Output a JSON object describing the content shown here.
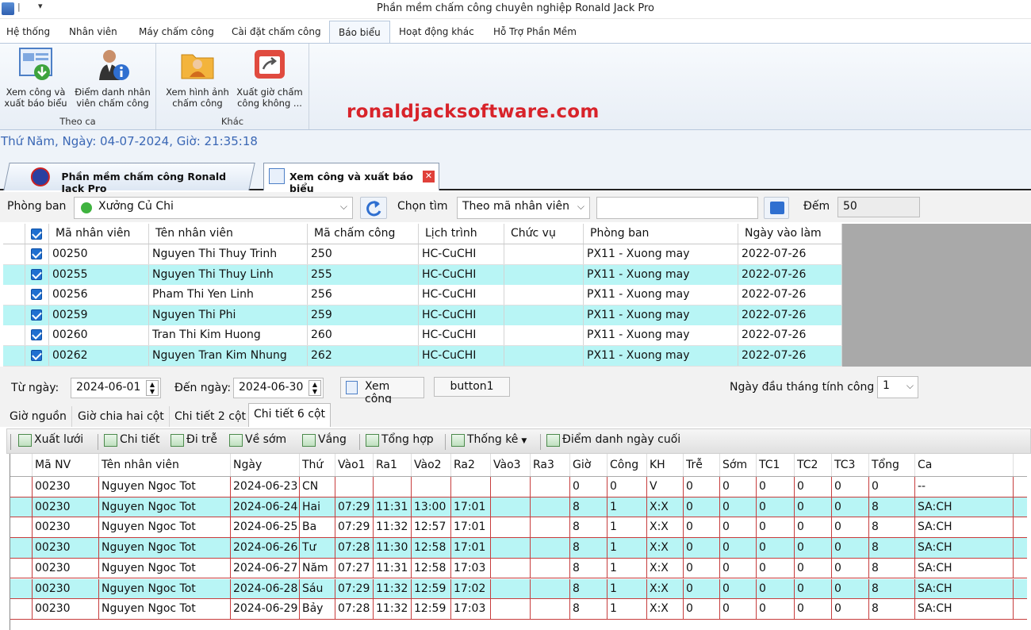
{
  "window": {
    "title": "Phần mềm chấm công chuyên nghiệp Ronald Jack Pro"
  },
  "menu": [
    "Hệ thống",
    "Nhân viên",
    "Máy chấm công",
    "Cài đặt chấm công",
    "Báo biểu",
    "Hoạt động khác",
    "Hỗ Trợ Phần Mềm"
  ],
  "ribbon": {
    "groups": [
      {
        "label": "Theo ca",
        "buttons": [
          "Xem công và xuất báo biểu",
          "Điểm danh nhân viên chấm công"
        ]
      },
      {
        "label": "Khác",
        "buttons": [
          "Xem hình ảnh chấm công",
          "Xuất giờ chấm công không ..."
        ]
      }
    ]
  },
  "watermark": "ronaldjacksoftware.com",
  "datetime": "Thứ Năm, Ngày: 04-07-2024, Giờ: 21:35:18",
  "doc_tabs": [
    "Phần mềm chấm công Ronald Jack Pro",
    "Xem công và xuất báo biểu"
  ],
  "filter": {
    "dept_label": "Phòng ban",
    "dept_value": "Xưởng Củ Chi",
    "search_label": "Chọn tìm",
    "search_mode": "Theo mã nhân viên",
    "search_text": "",
    "count_label": "Đếm",
    "count_value": "50"
  },
  "employees": {
    "columns": [
      "Mã nhân viên",
      "Tên nhân viên",
      "Mã chấm công",
      "Lịch trình",
      "Chức vụ",
      "Phòng ban",
      "Ngày vào làm"
    ],
    "rows": [
      [
        "00250",
        "Nguyen Thi Thuy Trinh",
        "250",
        "HC-CuCHI",
        "",
        "PX11 - Xuong may",
        "2022-07-26"
      ],
      [
        "00255",
        "Nguyen Thi Thuy Linh",
        "255",
        "HC-CuCHI",
        "",
        "PX11 - Xuong may",
        "2022-07-26"
      ],
      [
        "00256",
        "Pham Thi Yen Linh",
        "256",
        "HC-CuCHI",
        "",
        "PX11 - Xuong may",
        "2022-07-26"
      ],
      [
        "00259",
        "Nguyen Thi Phi",
        "259",
        "HC-CuCHI",
        "",
        "PX11 - Xuong may",
        "2022-07-26"
      ],
      [
        "00260",
        "Tran Thi Kim Huong",
        "260",
        "HC-CuCHI",
        "",
        "PX11 - Xuong may",
        "2022-07-26"
      ],
      [
        "00262",
        "Nguyen Tran Kim Nhung",
        "262",
        "HC-CuCHI",
        "",
        "PX11 - Xuong may",
        "2022-07-26"
      ]
    ]
  },
  "date_range": {
    "from_label": "Từ ngày:",
    "from_value": "2024-06-01",
    "to_label": "Đến ngày:",
    "to_value": "2024-06-30",
    "view_button": "Xem công",
    "button1": "button1",
    "first_day_label": "Ngày đầu tháng tính công",
    "first_day_value": "1"
  },
  "sub_tabs": [
    "Giờ nguồn",
    "Giờ chia hai cột",
    "Chi tiết 2 cột",
    "Chi tiết 6 cột"
  ],
  "toolbar": [
    "Xuất lưới",
    "Chi tiết",
    "Đi trễ",
    "Về sớm",
    "Vắng",
    "Tổng hợp",
    "Thống kê",
    "Điểm danh ngày cuối"
  ],
  "attendance": {
    "columns": [
      "Mã NV",
      "Tên nhân viên",
      "Ngày",
      "Thứ",
      "Vào1",
      "Ra1",
      "Vào2",
      "Ra2",
      "Vào3",
      "Ra3",
      "Giờ",
      "Công",
      "KH",
      "Trễ",
      "Sớm",
      "TC1",
      "TC2",
      "TC3",
      "Tổng",
      "Ca"
    ],
    "rows": [
      [
        "00230",
        "Nguyen Ngoc Tot",
        "2024-06-23",
        "CN",
        "",
        "",
        "",
        "",
        "",
        "",
        "0",
        "0",
        "V",
        "0",
        "0",
        "0",
        "0",
        "0",
        "0",
        "--"
      ],
      [
        "00230",
        "Nguyen Ngoc Tot",
        "2024-06-24",
        "Hai",
        "07:29",
        "11:31",
        "13:00",
        "17:01",
        "",
        "",
        "8",
        "1",
        "X:X",
        "0",
        "0",
        "0",
        "0",
        "0",
        "8",
        "SA:CH"
      ],
      [
        "00230",
        "Nguyen Ngoc Tot",
        "2024-06-25",
        "Ba",
        "07:29",
        "11:32",
        "12:57",
        "17:01",
        "",
        "",
        "8",
        "1",
        "X:X",
        "0",
        "0",
        "0",
        "0",
        "0",
        "8",
        "SA:CH"
      ],
      [
        "00230",
        "Nguyen Ngoc Tot",
        "2024-06-26",
        "Tư",
        "07:28",
        "11:30",
        "12:58",
        "17:01",
        "",
        "",
        "8",
        "1",
        "X:X",
        "0",
        "0",
        "0",
        "0",
        "0",
        "8",
        "SA:CH"
      ],
      [
        "00230",
        "Nguyen Ngoc Tot",
        "2024-06-27",
        "Năm",
        "07:27",
        "11:31",
        "12:58",
        "17:03",
        "",
        "",
        "8",
        "1",
        "X:X",
        "0",
        "0",
        "0",
        "0",
        "0",
        "8",
        "SA:CH"
      ],
      [
        "00230",
        "Nguyen Ngoc Tot",
        "2024-06-28",
        "Sáu",
        "07:29",
        "11:32",
        "12:59",
        "17:02",
        "",
        "",
        "8",
        "1",
        "X:X",
        "0",
        "0",
        "0",
        "0",
        "0",
        "8",
        "SA:CH"
      ],
      [
        "00230",
        "Nguyen Ngoc Tot",
        "2024-06-29",
        "Bảy",
        "07:28",
        "11:32",
        "12:59",
        "17:03",
        "",
        "",
        "8",
        "1",
        "X:X",
        "0",
        "0",
        "0",
        "0",
        "0",
        "8",
        "SA:CH"
      ]
    ]
  },
  "colors": {
    "row_alt": "#b8f5f5",
    "grid_border": "#c73d3d",
    "accent": "#3a67b5",
    "watermark": "#d8232a"
  }
}
